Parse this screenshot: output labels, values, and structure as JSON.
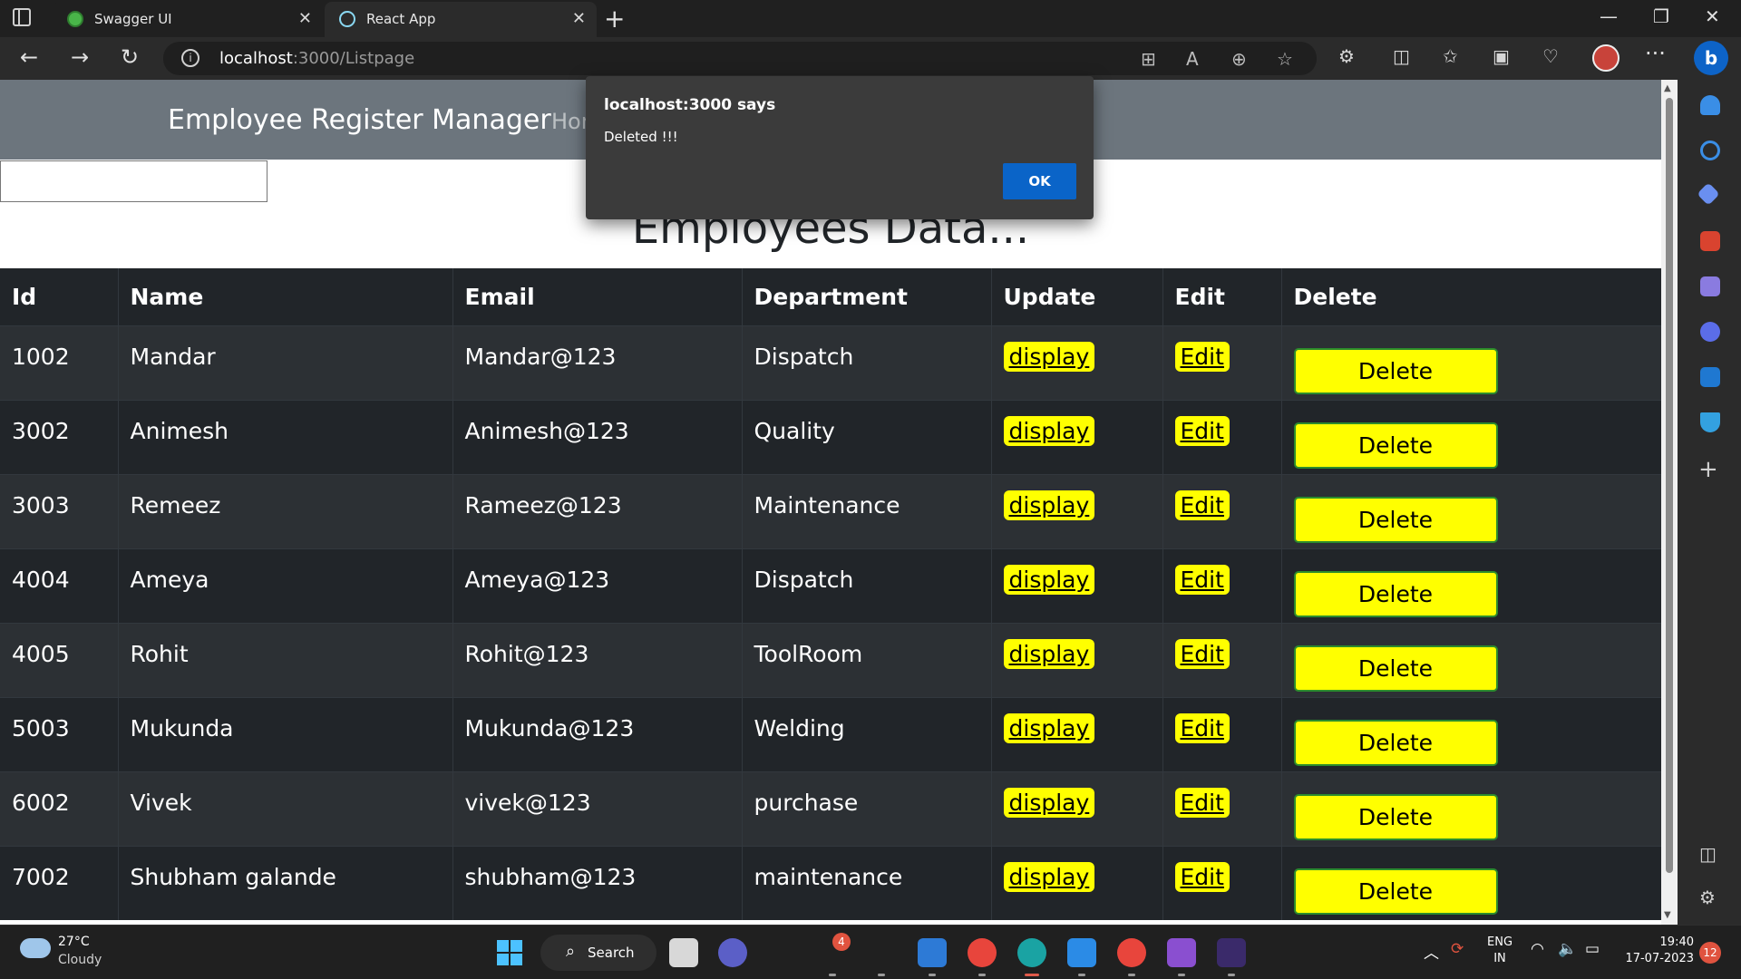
{
  "browser": {
    "tabs": [
      {
        "title": "Swagger UI",
        "active": false
      },
      {
        "title": "React App",
        "active": true
      }
    ],
    "url_host": "localhost",
    "url_path": ":3000/Listpage"
  },
  "navbar": {
    "brand": "Employee Register Manager",
    "link_home": "Hor"
  },
  "search": {
    "placeholder": ""
  },
  "page": {
    "heading": "Employees Data..."
  },
  "table": {
    "headers": [
      "Id",
      "Name",
      "Email",
      "Department",
      "Update",
      "Edit",
      "Delete"
    ],
    "update_label": "display",
    "edit_label": "Edit",
    "delete_label": "Delete",
    "rows": [
      {
        "id": "1002",
        "name": "Mandar",
        "email": "Mandar@123",
        "department": "Dispatch"
      },
      {
        "id": "3002",
        "name": "Animesh",
        "email": "Animesh@123",
        "department": "Quality"
      },
      {
        "id": "3003",
        "name": "Remeez",
        "email": "Rameez@123",
        "department": "Maintenance"
      },
      {
        "id": "4004",
        "name": "Ameya",
        "email": "Ameya@123",
        "department": "Dispatch"
      },
      {
        "id": "4005",
        "name": "Rohit",
        "email": "Rohit@123",
        "department": "ToolRoom"
      },
      {
        "id": "5003",
        "name": "Mukunda",
        "email": "Mukunda@123",
        "department": "Welding"
      },
      {
        "id": "6002",
        "name": "Vivek",
        "email": "vivek@123",
        "department": "purchase"
      },
      {
        "id": "7002",
        "name": "Shubham galande",
        "email": "shubham@123",
        "department": "maintenance"
      }
    ]
  },
  "alert": {
    "title": "localhost:3000 says",
    "message": "Deleted !!!",
    "ok_label": "OK"
  },
  "taskbar": {
    "weather_temp": "27°C",
    "weather_desc": "Cloudy",
    "search_label": "Search",
    "notification_count": "4",
    "lang_top": "ENG",
    "lang_bottom": "IN",
    "time": "19:40",
    "date": "17-07-2023",
    "tray_badge": "12"
  },
  "colors": {
    "navbar": "#6c757d",
    "table_dark": "#212529",
    "button_yellow": "#ffff00",
    "alert_ok": "#0a64c8"
  }
}
